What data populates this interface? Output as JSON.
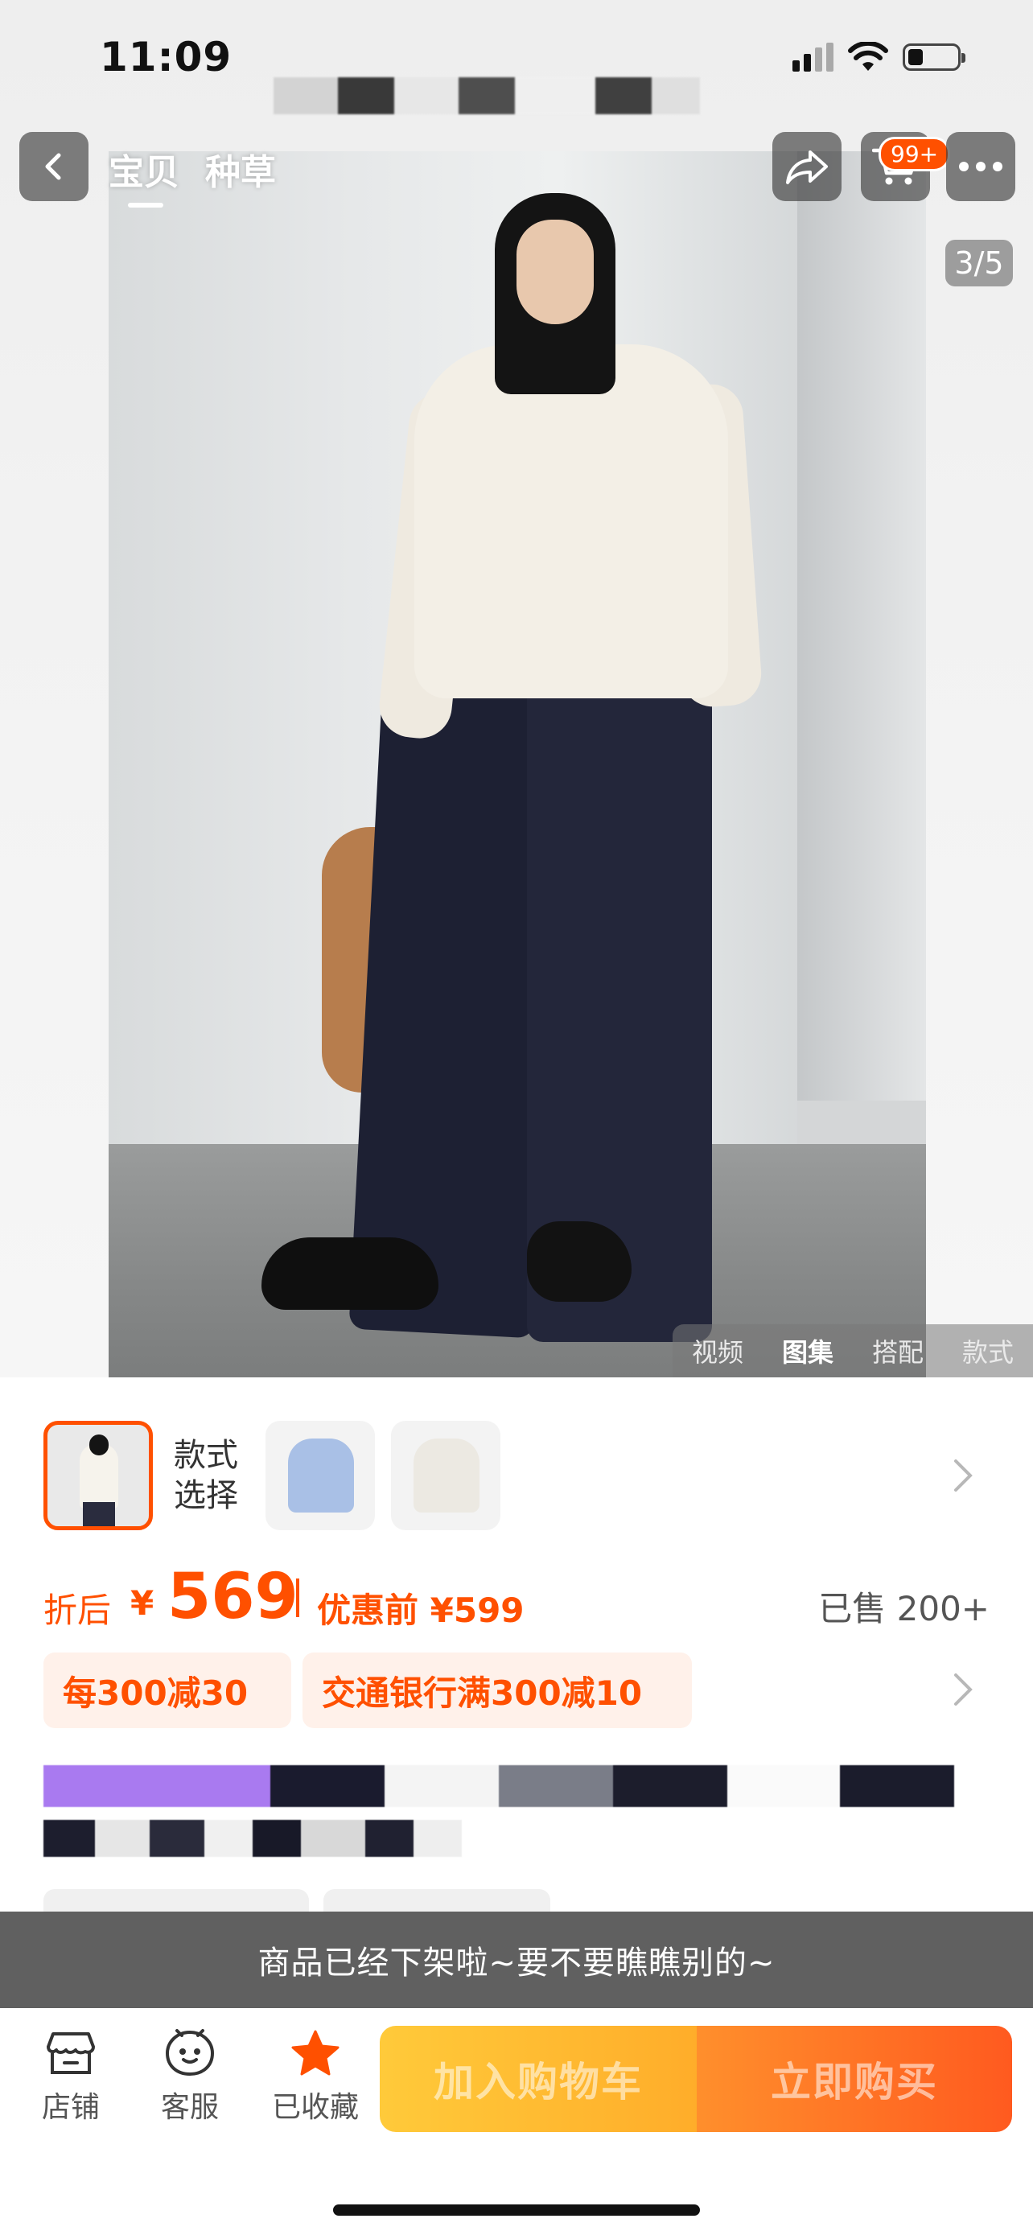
{
  "status_bar": {
    "time": "11:09"
  },
  "nav": {
    "tabs": [
      "宝贝",
      "种草"
    ],
    "cart_badge": "99+"
  },
  "gallery": {
    "counter": "3/5",
    "media_tabs": [
      "视频",
      "图集",
      "搭配",
      "款式"
    ],
    "active_media_tab": "图集"
  },
  "styles": {
    "label": "款式选择"
  },
  "price": {
    "after_label": "折后",
    "currency": "¥",
    "value": "569",
    "before_label": "优惠前",
    "before_value": "¥599",
    "sold": "已售 200+"
  },
  "promos": [
    "每300减30",
    "交通银行满300减10"
  ],
  "notice": "商品已经下架啦~要不要瞧瞧别的~",
  "bottom_bar": {
    "shop": "店铺",
    "service": "客服",
    "favorited": "已收藏",
    "add_to_cart": "加入购物车",
    "buy_now": "立即购买"
  },
  "colors": {
    "accent": "#ff5000",
    "cta_cart": "#ffb92e",
    "cta_buy": "#ff6a22",
    "notice_bg": "#606060"
  },
  "icons": [
    "back-icon",
    "share-icon",
    "cart-icon",
    "more-icon",
    "chevron-right-icon",
    "shop-icon",
    "service-icon",
    "star-icon"
  ]
}
